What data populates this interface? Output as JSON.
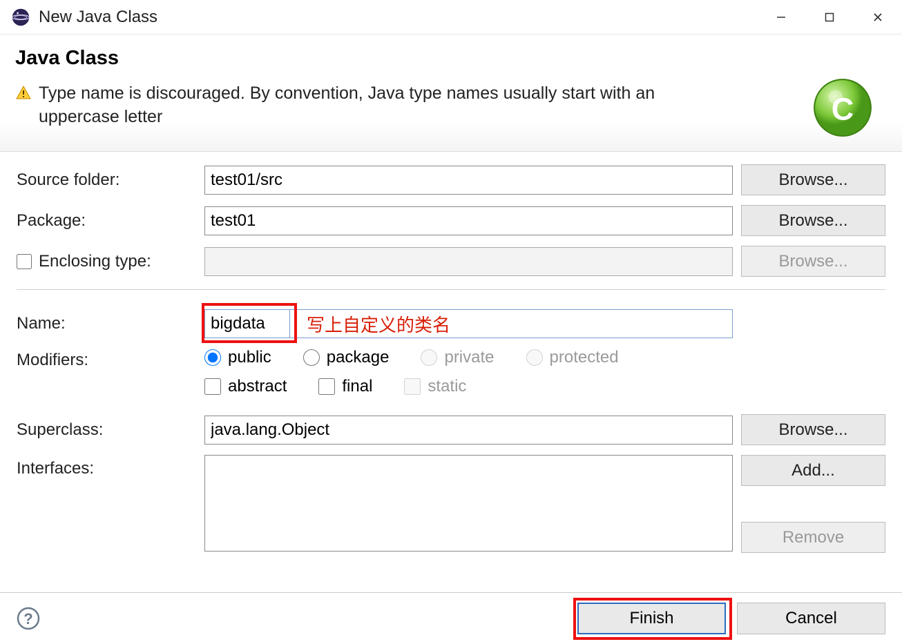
{
  "titlebar": {
    "title": "New Java Class"
  },
  "header": {
    "heading": "Java Class",
    "warning": "Type name is discouraged. By convention, Java type names usually start with an uppercase letter"
  },
  "form": {
    "sourceFolder": {
      "label": "Source folder:",
      "value": "test01/src",
      "browse": "Browse..."
    },
    "package": {
      "label": "Package:",
      "value": "test01",
      "browse": "Browse..."
    },
    "enclosing": {
      "label": "Enclosing type:",
      "value": "",
      "browse": "Browse..."
    },
    "name": {
      "label": "Name:",
      "value": "bigdata",
      "annotation": "写上自定义的类名"
    },
    "modifiers": {
      "label": "Modifiers:",
      "public": "public",
      "package": "package",
      "private": "private",
      "protected": "protected",
      "abstract": "abstract",
      "final": "final",
      "static": "static"
    },
    "superclass": {
      "label": "Superclass:",
      "value": "java.lang.Object",
      "browse": "Browse..."
    },
    "interfaces": {
      "label": "Interfaces:",
      "add": "Add...",
      "remove": "Remove"
    }
  },
  "footer": {
    "finish": "Finish",
    "cancel": "Cancel"
  }
}
